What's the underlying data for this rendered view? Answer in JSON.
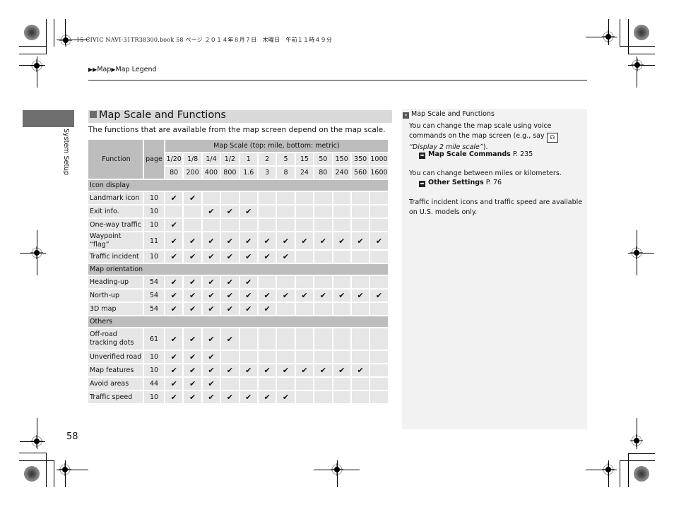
{
  "print_header": "15 CIVIC NAVI-31TR38300.book  58 ページ  ２０１４年８月７日　木曜日　午前１１時４９分",
  "breadcrumb": {
    "prefix_icon": "double-arrow-icon",
    "items": [
      "Map",
      "Map Legend"
    ]
  },
  "side_tab": {
    "label": "System Setup"
  },
  "section": {
    "title": "Map Scale and Functions",
    "intro": "The functions that are available from the map screen depend on the map scale."
  },
  "table": {
    "headers": {
      "function": "Function",
      "page": "page",
      "scale_title": "Map Scale (top: mile, bottom: metric)"
    },
    "scales_mile": [
      "1/20",
      "1/8",
      "1/4",
      "1/2",
      "1",
      "2",
      "5",
      "15",
      "50",
      "150",
      "350",
      "1000"
    ],
    "scales_metric": [
      "80",
      "200",
      "400",
      "800",
      "1.6",
      "3",
      "8",
      "24",
      "80",
      "240",
      "560",
      "1600"
    ],
    "check_glyph": "✔",
    "groups": [
      {
        "label": "Icon display",
        "rows": [
          {
            "function": "Landmark icon",
            "page": "10",
            "checks": [
              1,
              1,
              0,
              0,
              0,
              0,
              0,
              0,
              0,
              0,
              0,
              0
            ]
          },
          {
            "function": "Exit info.",
            "page": "10",
            "checks": [
              0,
              0,
              1,
              1,
              1,
              0,
              0,
              0,
              0,
              0,
              0,
              0
            ]
          },
          {
            "function": "One-way traffic",
            "page": "10",
            "checks": [
              1,
              0,
              0,
              0,
              0,
              0,
              0,
              0,
              0,
              0,
              0,
              0
            ]
          },
          {
            "function": "Waypoint “flag”",
            "page": "11",
            "checks": [
              1,
              1,
              1,
              1,
              1,
              1,
              1,
              1,
              1,
              1,
              1,
              1
            ]
          },
          {
            "function": "Traffic incident",
            "page": "10",
            "checks": [
              1,
              1,
              1,
              1,
              1,
              1,
              1,
              0,
              0,
              0,
              0,
              0
            ]
          }
        ]
      },
      {
        "label": "Map orientation",
        "rows": [
          {
            "function": "Heading-up",
            "page": "54",
            "checks": [
              1,
              1,
              1,
              1,
              1,
              0,
              0,
              0,
              0,
              0,
              0,
              0
            ]
          },
          {
            "function": "North-up",
            "page": "54",
            "checks": [
              1,
              1,
              1,
              1,
              1,
              1,
              1,
              1,
              1,
              1,
              1,
              1
            ]
          },
          {
            "function": "3D map",
            "page": "54",
            "checks": [
              1,
              1,
              1,
              1,
              1,
              1,
              0,
              0,
              0,
              0,
              0,
              0
            ]
          }
        ]
      },
      {
        "label": "Others",
        "rows": [
          {
            "function": "Off-road tracking dots",
            "page": "61",
            "checks": [
              1,
              1,
              1,
              1,
              0,
              0,
              0,
              0,
              0,
              0,
              0,
              0
            ]
          },
          {
            "function": "Unverified road",
            "page": "10",
            "checks": [
              1,
              1,
              1,
              0,
              0,
              0,
              0,
              0,
              0,
              0,
              0,
              0
            ]
          },
          {
            "function": "Map features",
            "page": "10",
            "checks": [
              1,
              1,
              1,
              1,
              1,
              1,
              1,
              1,
              1,
              1,
              1,
              0
            ]
          },
          {
            "function": "Avoid areas",
            "page": "44",
            "checks": [
              1,
              1,
              1,
              0,
              0,
              0,
              0,
              0,
              0,
              0,
              0,
              0
            ]
          },
          {
            "function": "Traffic speed",
            "page": "10",
            "checks": [
              1,
              1,
              1,
              1,
              1,
              1,
              1,
              0,
              0,
              0,
              0,
              0
            ]
          }
        ]
      }
    ]
  },
  "side_panel": {
    "title": "Map Scale and Functions",
    "para1_a": "You can change the map scale using voice commands on the map screen (e.g., say",
    "para1_voice_icon": "talk-button-icon",
    "para1_quote": "“Display 2 mile scale”",
    "para1_end": ").",
    "link1": {
      "label": "Map Scale Commands",
      "page": "P. 235"
    },
    "para2": "You can change between miles or kilometers.",
    "link2": {
      "label": "Other Settings",
      "page": "P. 76"
    },
    "para3": "Traffic incident icons and traffic speed are available on U.S. models only."
  },
  "page_number": "58"
}
